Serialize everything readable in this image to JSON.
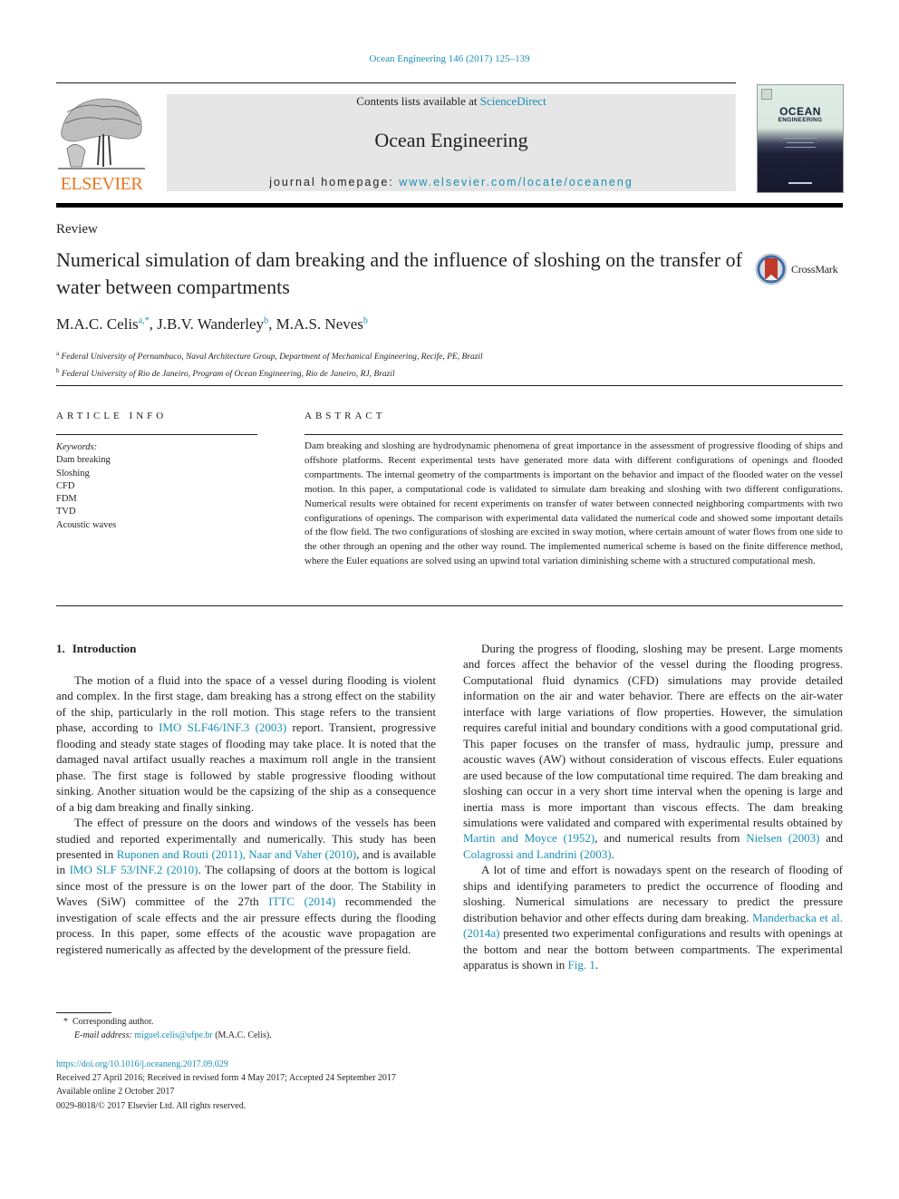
{
  "header": {
    "journal_ref": "Ocean Engineering 146 (2017) 125–139",
    "publisher_logo_text": "ELSEVIER",
    "contents_prefix": "Contents lists available at ",
    "contents_link": "ScienceDirect",
    "journal_title": "Ocean Engineering",
    "homepage_prefix": "journal homepage: ",
    "homepage_link": "www.elsevier.com/locate/oceaneng",
    "cover": {
      "title_line1": "OCEAN",
      "title_line2": "ENGINEERING"
    }
  },
  "article": {
    "type": "Review",
    "title": "Numerical simulation of dam breaking and the influence of sloshing on the transfer of water between compartments",
    "crossmark_label": "CrossMark",
    "authors": [
      {
        "name": "M.A.C. Celis",
        "sup": "a,*"
      },
      {
        "name": "J.B.V. Wanderley",
        "sup": "b"
      },
      {
        "name": "M.A.S. Neves",
        "sup": "b"
      }
    ],
    "affiliations": [
      {
        "key": "a",
        "text": "Federal University of Pernambuco, Naval Architecture Group, Department of Mechanical Engineering, Recife, PE, Brazil"
      },
      {
        "key": "b",
        "text": "Federal University of Rio de Janeiro, Program of Ocean Engineering, Rio de Janeiro, RJ, Brazil"
      }
    ]
  },
  "article_info": {
    "heading": "ARTICLE INFO",
    "keywords_label": "Keywords:",
    "keywords": [
      "Dam breaking",
      "Sloshing",
      "CFD",
      "FDM",
      "TVD",
      "Acoustic waves"
    ]
  },
  "abstract": {
    "heading": "ABSTRACT",
    "text": "Dam breaking and sloshing are hydrodynamic phenomena of great importance in the assessment of progressive flooding of ships and offshore platforms. Recent experimental tests have generated more data with different configurations of openings and flooded compartments. The internal geometry of the compartments is important on the behavior and impact of the flooded water on the vessel motion. In this paper, a computational code is validated to simulate dam breaking and sloshing with two different configurations. Numerical results were ob­tained for recent experiments on transfer of water between connected neighboring compartments with two configurations of openings. The comparison with experimental data validated the numerical code and showed some important details of the flow field. The two configurations of sloshing are excited in sway motion, where certain amount of water flows from one side to the other through an opening and the other way round. The implemented numerical scheme is based on the finite difference method, where the Euler equations are solved using an upwind total variation diminishing scheme with a structured computational mesh."
  },
  "introduction": {
    "number": "1.",
    "heading": "Introduction",
    "left_paragraphs": [
      [
        {
          "t": "The motion of a fluid into the space of a vessel during flooding is violent and complex. In the first stage, dam breaking has a strong effect on the stability of the ship, particularly in the roll motion. This stage refers to the transient phase, according to "
        },
        {
          "t": "IMO SLF46/INF.3 (2003)",
          "link": true
        },
        {
          "t": " report. Transient, progressive flooding and steady state stages of flooding may take place. It is noted that the damaged naval artifact usually reaches a maximum roll angle in the transient phase. The first stage is followed by stable progressive flooding without sinking. Another situation would be the capsizing of the ship as a consequence of a big dam breaking and finally sinking."
        }
      ],
      [
        {
          "t": "The effect of pressure on the doors and windows of the vessels has been studied and reported experimentally and numerically. This study has been presented in "
        },
        {
          "t": "Ruponen and Routi (2011), Naar and Vaher (2010)",
          "link": true
        },
        {
          "t": ", and is available in "
        },
        {
          "t": "IMO SLF 53/INF.2 (2010)",
          "link": true
        },
        {
          "t": ". The collapsing of doors at the bottom is logical since most of the pressure is on the lower part of the door. The Stability in Waves (SiW) committee of the 27th "
        },
        {
          "t": "ITTC (2014)",
          "link": true
        },
        {
          "t": " recommended the investigation of scale effects and the air pres­sure effects during the flooding process. In this paper, some effects of the acoustic wave propagation are registered numerically as affected by the development of the pressure field."
        }
      ]
    ],
    "right_paragraphs": [
      [
        {
          "t": "During the progress of flooding, sloshing may be present. Large mo­ments and forces affect the behavior of the vessel during the flooding progress. Computational fluid dynamics (CFD) simulations may provide detailed information on the air and water behavior. There are effects on the air-water interface with large variations of flow properties. However, the simulation requires careful initial and boundary conditions with a good computational grid. This paper focuses on the transfer of mass, hydraulic jump, pressure and acoustic waves (AW) without consideration of viscous effects. Euler equations are used because of the low compu­tational time required. The dam breaking and sloshing can occur in a very short time interval when the opening is large and inertia mass is more important than viscous effects. The dam breaking simulations were validated and compared with experimental results obtained by "
        },
        {
          "t": "Martin and Moyce (1952)",
          "link": true
        },
        {
          "t": ", and numerical results from "
        },
        {
          "t": "Nielsen (2003)",
          "link": true
        },
        {
          "t": " and "
        },
        {
          "t": "Colagrossi and Landrini (2003)",
          "link": true
        },
        {
          "t": "."
        }
      ],
      [
        {
          "t": "A lot of time and effort is nowadays spent on the research of flooding of ships and identifying parameters to predict the occurrence of flooding and sloshing. Numerical simulations are necessary to predict the pressure distribution behavior and other effects during dam breaking. "
        },
        {
          "t": "Man­derbacka et al. (2014a)",
          "link": true
        },
        {
          "t": " presented two experimental configurations and results with openings at the bottom and near the bottom between com­partments. The experimental apparatus is shown in "
        },
        {
          "t": "Fig. 1",
          "link": true
        },
        {
          "t": "."
        }
      ]
    ]
  },
  "footnotes": {
    "corresponding_marker": "*",
    "corresponding_text": "Corresponding author.",
    "email_label": "E-mail address:",
    "email": "miguel.celis@ufpe.br",
    "email_suffix": " (M.A.C. Celis)."
  },
  "publication": {
    "doi": "https://doi.org/10.1016/j.oceaneng.2017.09.029",
    "history": "Received 27 April 2016; Received in revised form 4 May 2017; Accepted 24 September 2017",
    "available_online": "Available online 2 October 2017",
    "copyright": "0029-8018/© 2017 Elsevier Ltd. All rights reserved."
  }
}
